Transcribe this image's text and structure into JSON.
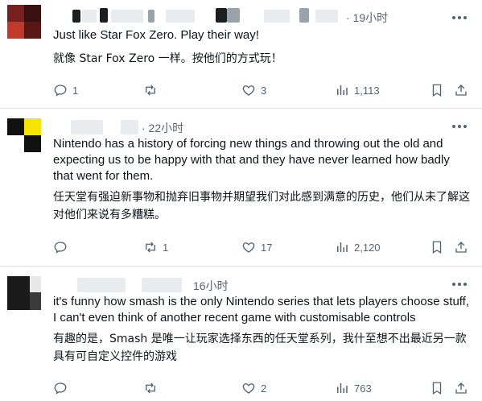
{
  "feed": {
    "posts": [
      {
        "time": "· 19小时",
        "text_en": "Just like Star Fox Zero. Play their way!",
        "text_zh": "就像 Star Fox Zero 一样。按他们的方式玩！",
        "replies": "1",
        "retweets": "",
        "likes": "3",
        "views": "1,113",
        "avatar_colors": [
          "#7a1f1f",
          "#c0392b",
          "#3a1010",
          "#e0e0e0"
        ]
      },
      {
        "time": "· 22小时",
        "text_en": "Nintendo has a history of forcing new things and throwing out the old and expecting us to be happy with that and they have never learned how badly that went for them.",
        "text_zh": "任天堂有强迫新事物和抛弃旧事物并期望我们对此感到满意的历史，他们从未了解这对他们来说有多糟糕。",
        "replies": "",
        "retweets": "1",
        "likes": "17",
        "views": "2,120",
        "avatar_colors": [
          "#111111",
          "#f5e400",
          "#ffffff",
          "#111111"
        ]
      },
      {
        "time": "16小时",
        "text_en": "it's funny how smash is the only Nintendo series that lets players choose stuff, I can't even think of another recent game with customisable controls",
        "text_zh": "有趣的是，Smash 是唯一让玩家选择东西的任天堂系列，我什至想不出最近另一款具有可自定义控件的游戏",
        "replies": "",
        "retweets": "",
        "likes": "2",
        "views": "763",
        "avatar_colors": [
          "#1a1a1a",
          "#3b3b3b",
          "#555555",
          "#2a2a2a"
        ]
      }
    ]
  },
  "icons": {
    "reply": "reply-icon",
    "retweet": "retweet-icon",
    "like": "heart-icon",
    "views": "views-icon",
    "bookmark": "bookmark-icon",
    "share": "share-icon",
    "more": "more-icon"
  },
  "colors": {
    "text": "#0f1419",
    "muted": "#536471",
    "divider": "#dfe3e6"
  }
}
